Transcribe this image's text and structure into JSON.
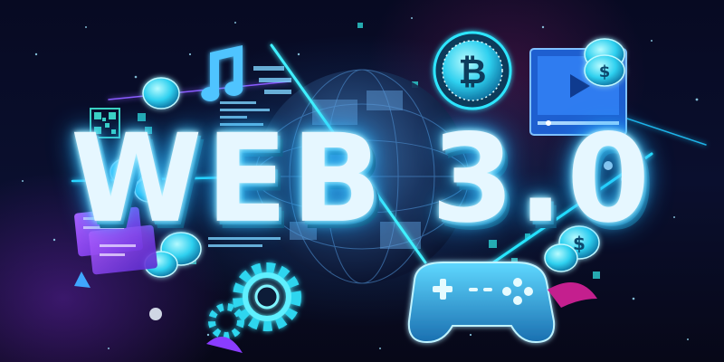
{
  "headline": "WEB 3.0",
  "icons": {
    "bitcoin": "bitcoin-coin-icon",
    "dollar": "dollar-coin-icon",
    "music": "music-note-icon",
    "video": "video-player-icon",
    "gamepad": "gamepad-icon",
    "gear": "gear-icon",
    "qr": "qr-code-icon",
    "globe": "globe-icon"
  },
  "colors": {
    "background": "#070a22",
    "neon_cyan": "#2fe6ff",
    "neon_blue": "#1aa8ff",
    "purple": "#8a3cff",
    "magenta": "#c41f8e"
  }
}
